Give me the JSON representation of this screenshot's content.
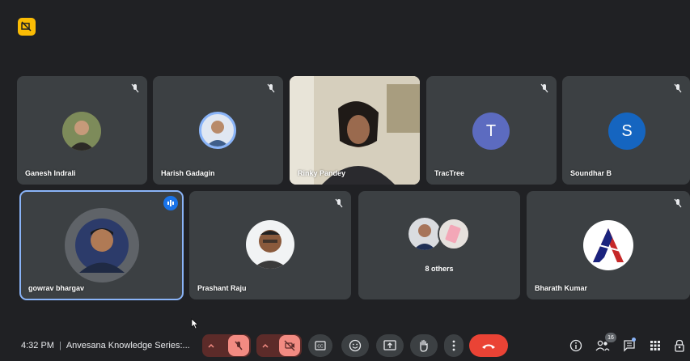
{
  "participants_row1": [
    {
      "name": "Ganesh Indrali"
    },
    {
      "name": "Harish Gadagin"
    },
    {
      "name": "Rinky Pandey"
    },
    {
      "name": "TracTree",
      "initial": "T",
      "color": "#5c6bc0"
    },
    {
      "name": "Soundhar B",
      "initial": "S",
      "color": "#1565c0"
    }
  ],
  "participants_row2": [
    {
      "name": "gowrav bhargav"
    },
    {
      "name": "Prashant Raju"
    },
    {
      "name": "8 others"
    },
    {
      "name": "Bharath Kumar"
    }
  ],
  "footer": {
    "time": "4:32 PM",
    "separator": "|",
    "meeting_title": "Anvesana Knowledge Series:...",
    "participant_count": "16"
  },
  "colors": {
    "background": "#202124",
    "tile": "#3c4043",
    "active_border": "#8ab4f8",
    "hangup": "#ea4335",
    "muted_control": "#f28b82",
    "recording_badge": "#fbbc04"
  }
}
